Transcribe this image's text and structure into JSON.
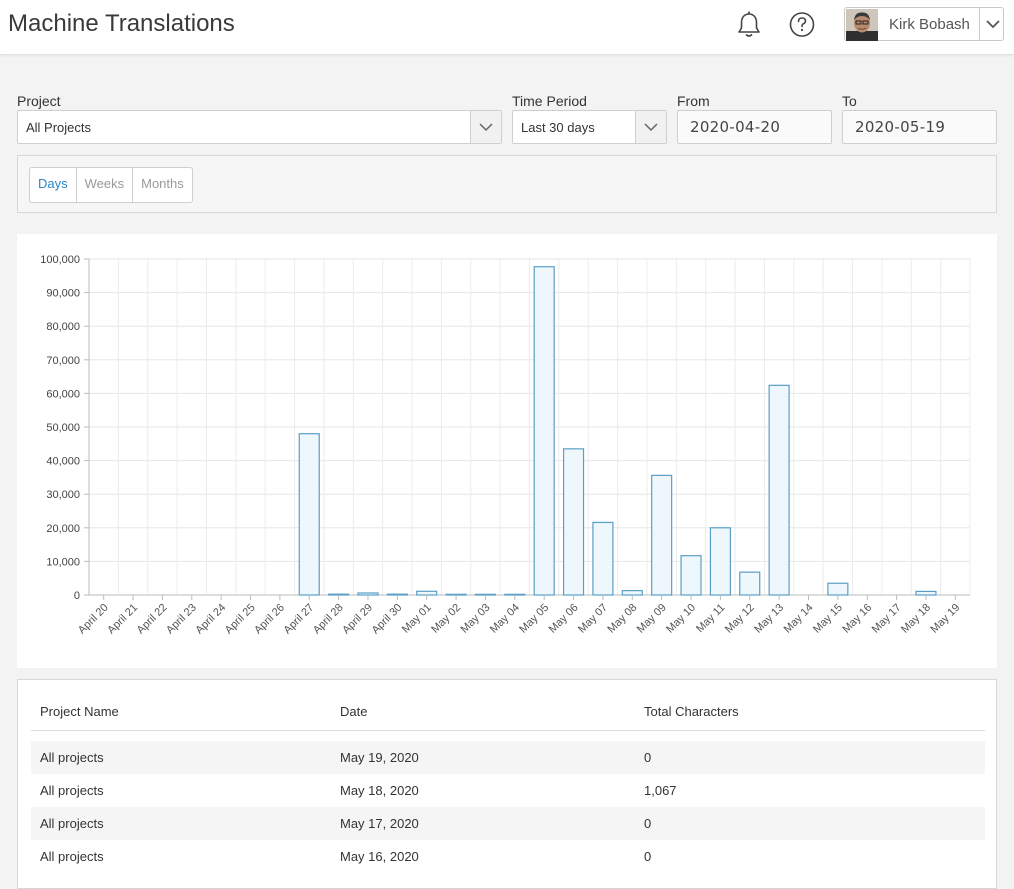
{
  "header": {
    "title": "Machine Translations",
    "user_name": "Kirk Bobash",
    "icons": [
      "bell-icon",
      "help-icon",
      "chevron-down-icon"
    ]
  },
  "filters": {
    "project_label": "Project",
    "project_value": "All Projects",
    "period_label": "Time Period",
    "period_value": "Last 30 days",
    "from_label": "From",
    "from_value": "2020-04-20",
    "to_label": "To",
    "to_value": "2020-05-19"
  },
  "granularity": {
    "options": [
      "Days",
      "Weeks",
      "Months"
    ],
    "selected": "Days",
    "accent": "#2a86c8"
  },
  "chart_data": {
    "type": "bar",
    "categories": [
      "April 20",
      "April 21",
      "April 22",
      "April 23",
      "April 24",
      "April 25",
      "April 26",
      "April 27",
      "April 28",
      "April 29",
      "April 30",
      "May 01",
      "May 02",
      "May 03",
      "May 04",
      "May 05",
      "May 06",
      "May 07",
      "May 08",
      "May 09",
      "May 10",
      "May 11",
      "May 12",
      "May 13",
      "May 14",
      "May 15",
      "May 16",
      "May 17",
      "May 18",
      "May 19"
    ],
    "values": [
      0,
      0,
      0,
      0,
      0,
      0,
      0,
      48000,
      250,
      600,
      250,
      1100,
      200,
      200,
      200,
      97700,
      43500,
      21600,
      1300,
      35600,
      11700,
      20000,
      6800,
      62400,
      0,
      3500,
      0,
      0,
      1067,
      0
    ],
    "ylim": [
      0,
      100000
    ],
    "yticks": [
      "0",
      "10,000",
      "20,000",
      "30,000",
      "40,000",
      "50,000",
      "60,000",
      "70,000",
      "80,000",
      "90,000",
      "100,000"
    ],
    "grid": true,
    "bar_fill": "#edf7fc",
    "bar_stroke": "#5b9fc6"
  },
  "table": {
    "headers": [
      "Project Name",
      "Date",
      "Total Characters"
    ],
    "rows": [
      [
        "All projects",
        "May 19, 2020",
        "0"
      ],
      [
        "All projects",
        "May 18, 2020",
        "1,067"
      ],
      [
        "All projects",
        "May 17, 2020",
        "0"
      ],
      [
        "All projects",
        "May 16, 2020",
        "0"
      ]
    ]
  }
}
